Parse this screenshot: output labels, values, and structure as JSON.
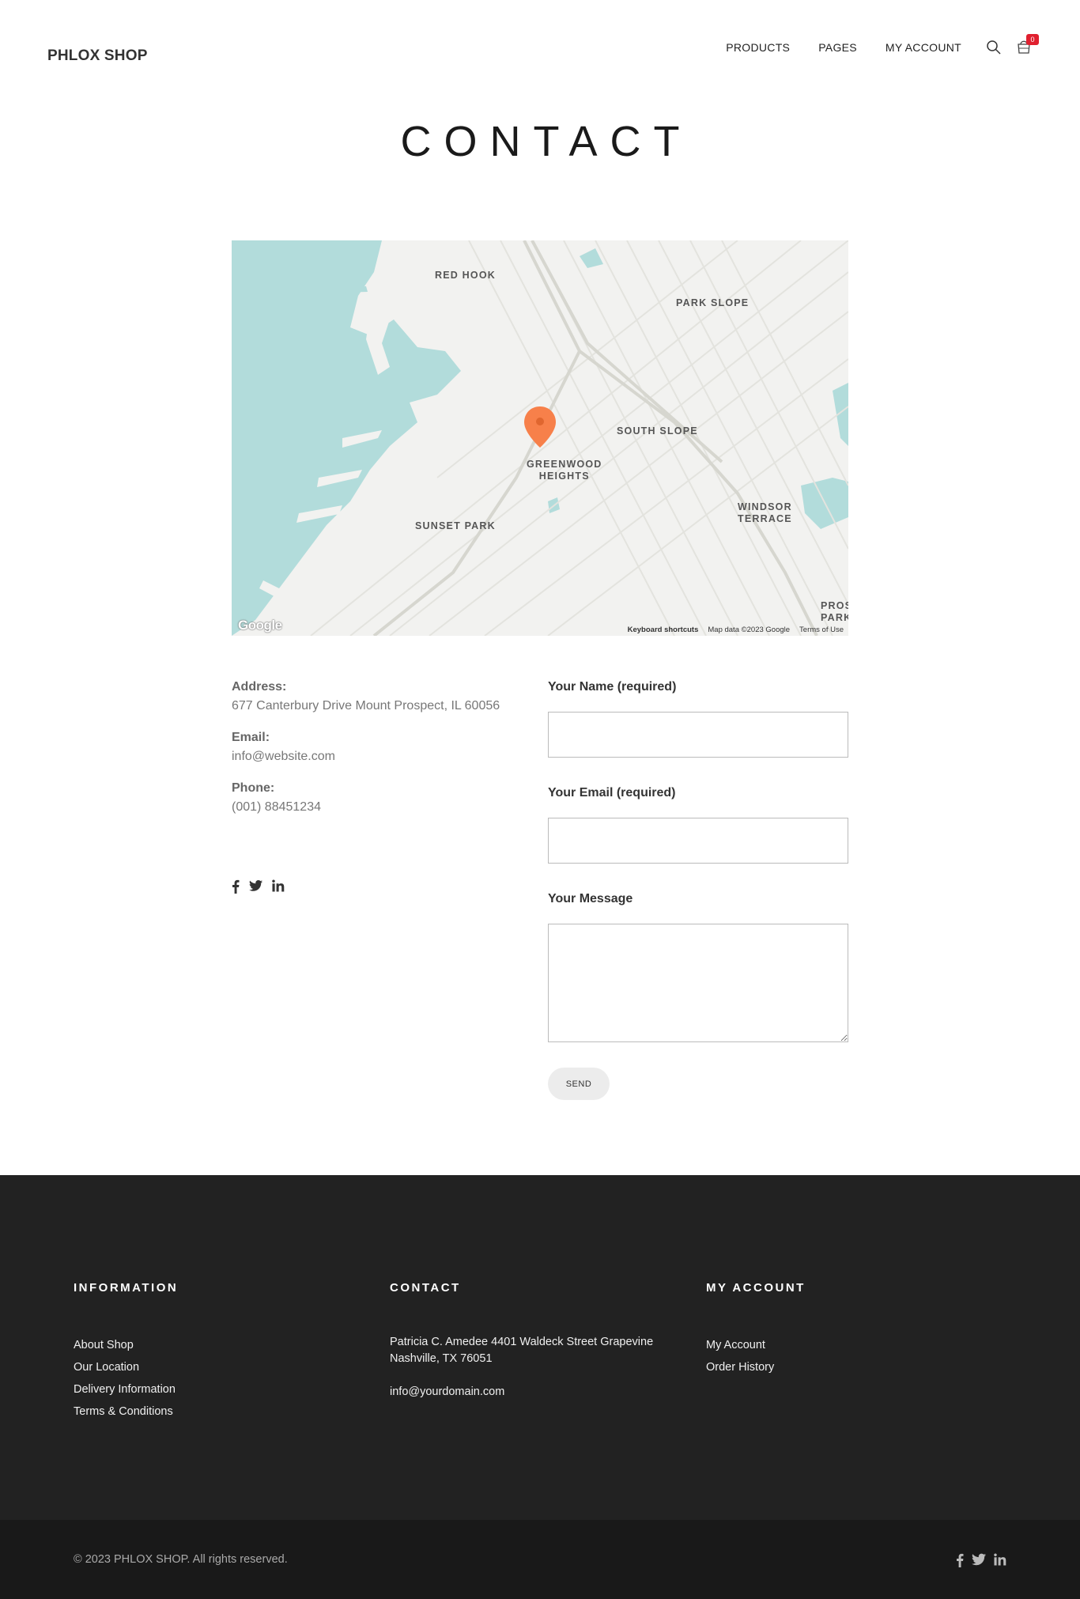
{
  "header": {
    "logo": "PHLOX SHOP",
    "nav": [
      "PRODUCTS",
      "PAGES",
      "MY ACCOUNT"
    ],
    "cart_count": "0"
  },
  "page_title": "CONTACT",
  "map": {
    "labels": {
      "red_hook": "RED HOOK",
      "park_slope": "PARK SLOPE",
      "south_slope": "SOUTH SLOPE",
      "greenwood_heights": "GREENWOOD\nHEIGHTS",
      "sunset_park": "SUNSET PARK",
      "windsor_terrace": "WINDSOR\nTERRACE",
      "prospect_park": "PROS\nPARK"
    },
    "google_logo": "Google",
    "footer": {
      "keyboard": "Keyboard shortcuts",
      "map_data": "Map data ©2023 Google",
      "terms": "Terms of Use"
    },
    "colors": {
      "water": "#b2dcdb",
      "land": "#f2f2f0",
      "road": "#dcdcd6",
      "marker": "#f7804a"
    }
  },
  "contact_info": {
    "address_label": "Address:",
    "address_value": "677 Canterbury Drive Mount Prospect, IL 60056",
    "email_label": "Email:",
    "email_value": "info@website.com",
    "phone_label": "Phone:",
    "phone_value": "(001) 88451234",
    "social_icons": [
      "facebook-icon",
      "twitter-icon",
      "linkedin-icon"
    ]
  },
  "form": {
    "name_label": "Your Name (required)",
    "name_value": "",
    "email_label": "Your Email (required)",
    "email_value": "",
    "message_label": "Your Message",
    "message_value": "",
    "send_label": "SEND"
  },
  "footer": {
    "information": {
      "heading": "INFORMATION",
      "links": [
        "About Shop",
        "Our Location",
        "Delivery Information",
        "Terms & Conditions"
      ]
    },
    "contact": {
      "heading": "CONTACT",
      "address": "Patricia C. Amedee 4401 Waldeck Street Grapevine Nashville, TX 76051",
      "email": "info@yourdomain.com"
    },
    "my_account": {
      "heading": "MY ACCOUNT",
      "links": [
        "My Account",
        "Order History"
      ]
    },
    "copyright": "© 2023 PHLOX SHOP. All rights reserved.",
    "colors": {
      "footer_bg": "#222222",
      "bottom_bg": "#191919"
    }
  }
}
